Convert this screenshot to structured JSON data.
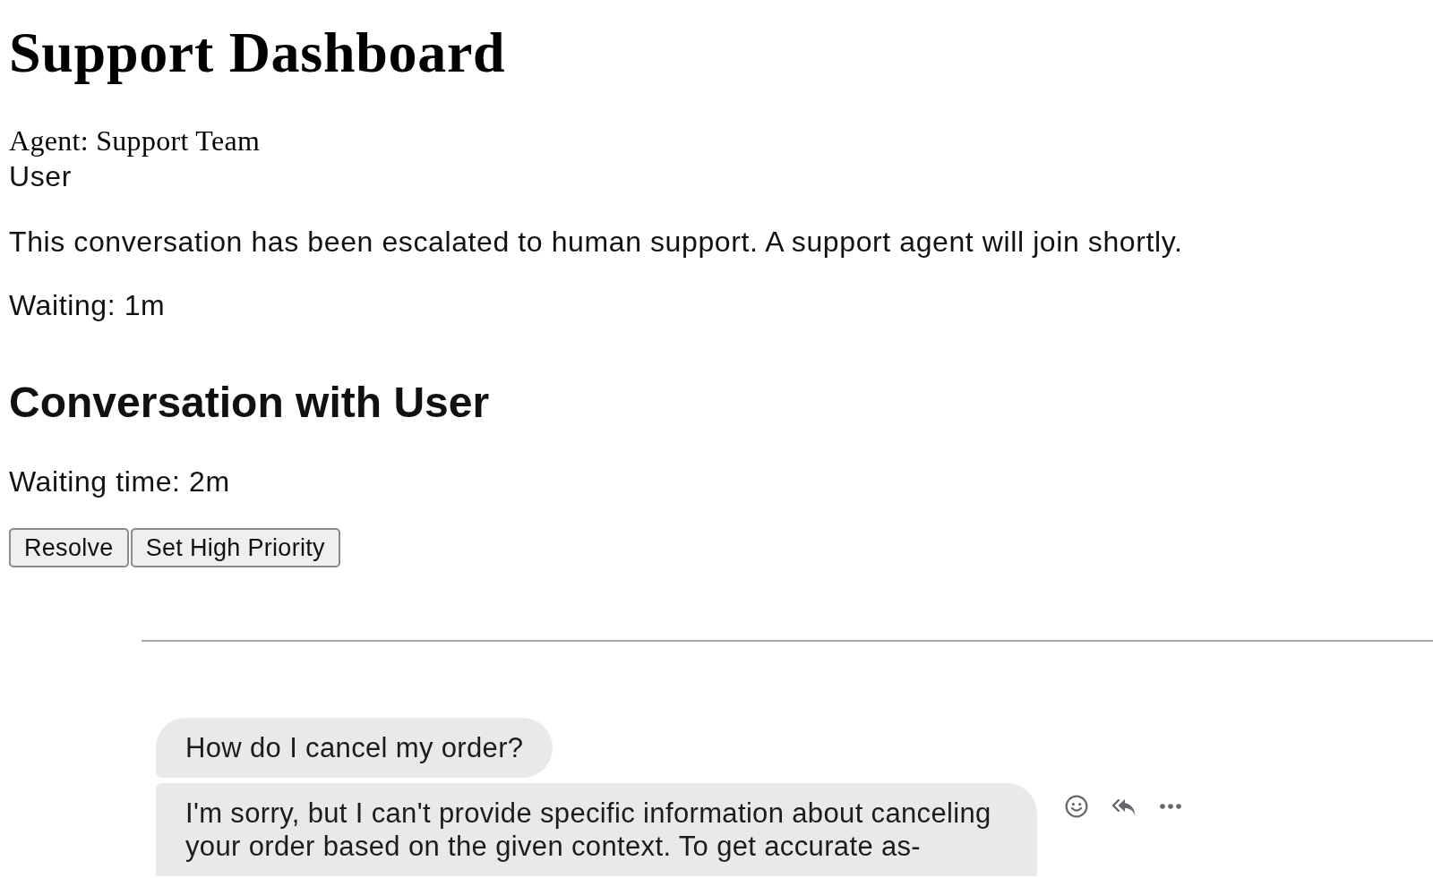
{
  "page": {
    "title": "Support Dashboard"
  },
  "agent": "Agent: Support Team",
  "user": "User",
  "notice": "This conversation has been escalated to human support. A support agent will join shortly.",
  "waiting": "Waiting: 1m",
  "conversation": {
    "heading": "Conversation with User",
    "waiting_time": "Waiting time: 2m",
    "buttons": [
      "Resolve",
      "Set High Priority"
    ],
    "messages": [
      {
        "text": "How do I cancel my order?",
        "hovered": false
      },
      {
        "text": "I'm sorry, but I can't provide specific information about canceling your order based on the given context. To get accurate as-",
        "hovered": true
      }
    ]
  }
}
